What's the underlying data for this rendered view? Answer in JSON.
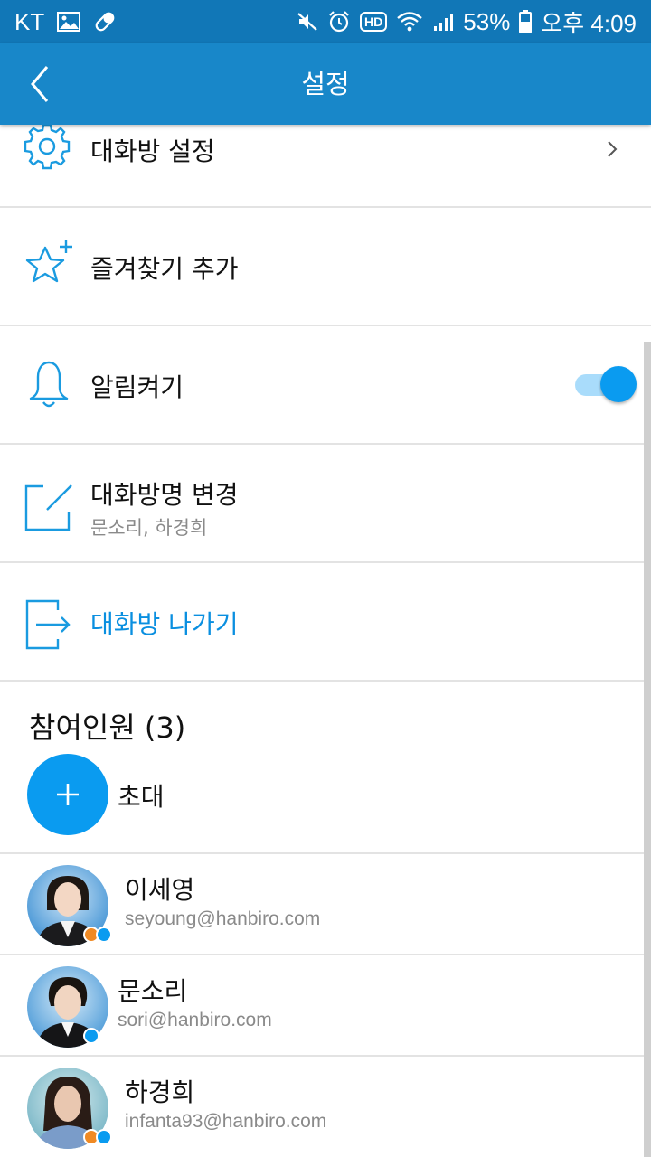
{
  "status_bar": {
    "carrier": "KT",
    "battery": "53%",
    "time": "오후 4:09",
    "hd_label": "HD",
    "icons": [
      "image-icon",
      "pill-icon",
      "mute-icon",
      "alarm-icon",
      "hd-icon",
      "wifi-icon",
      "signal-icon",
      "battery-icon"
    ]
  },
  "appbar": {
    "title": "설정"
  },
  "settings": {
    "chat_settings": "대화방 설정",
    "add_favorite": "즐겨찾기 추가",
    "notifications": "알림켜기",
    "notifications_on": true,
    "rename": "대화방명 변경",
    "rename_sub": "문소리, 하경희",
    "leave": "대화방 나가기"
  },
  "participants": {
    "title": "참여인원 (3)",
    "invite_label": "초대",
    "members": [
      {
        "name": "이세영",
        "email": "seyoung@hanbiro.com"
      },
      {
        "name": "문소리",
        "email": "sori@hanbiro.com"
      },
      {
        "name": "하경희",
        "email": "infanta93@hanbiro.com"
      }
    ]
  },
  "colors": {
    "statusbar": "#1177b7",
    "appbar": "#1887c9",
    "accent": "#0a9bf0",
    "icon_blue": "#1a9be0"
  }
}
